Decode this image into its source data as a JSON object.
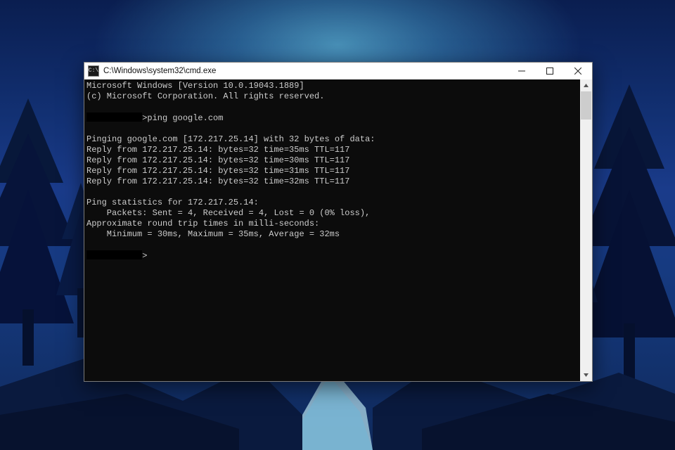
{
  "window": {
    "title": "C:\\Windows\\system32\\cmd.exe",
    "icon_label": "C:\\"
  },
  "terminal": {
    "header_line1": "Microsoft Windows [Version 10.0.19043.1889]",
    "header_line2": "(c) Microsoft Corporation. All rights reserved.",
    "prompt1_hidden_width_ch": 11,
    "prompt1_visible": ">ping google.com",
    "pinging_line": "Pinging google.com [172.217.25.14] with 32 bytes of data:",
    "reply1": "Reply from 172.217.25.14: bytes=32 time=35ms TTL=117",
    "reply2": "Reply from 172.217.25.14: bytes=32 time=30ms TTL=117",
    "reply3": "Reply from 172.217.25.14: bytes=32 time=31ms TTL=117",
    "reply4": "Reply from 172.217.25.14: bytes=32 time=32ms TTL=117",
    "stats_header": "Ping statistics for 172.217.25.14:",
    "stats_packets": "    Packets: Sent = 4, Received = 4, Lost = 0 (0% loss),",
    "stats_rtt_header": "Approximate round trip times in milli-seconds:",
    "stats_rtt_values": "    Minimum = 30ms, Maximum = 35ms, Average = 32ms",
    "prompt2_hidden_width_ch": 11,
    "prompt2_visible": ">"
  }
}
